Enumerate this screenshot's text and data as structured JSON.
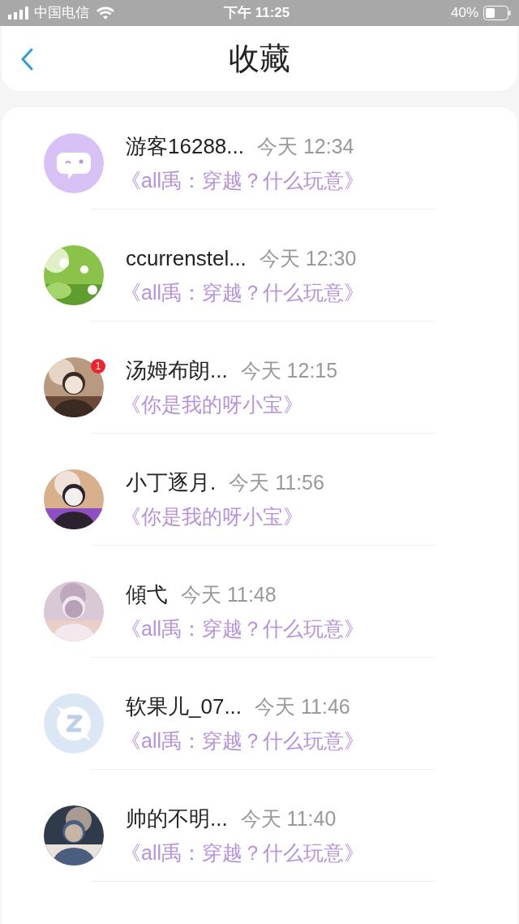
{
  "status_bar": {
    "carrier": "中国电信",
    "time": "下午 11:25",
    "battery": "40%"
  },
  "header": {
    "title": "收藏"
  },
  "items": [
    {
      "name": "游客16288...",
      "time": "今天 12:34",
      "title": "《all禹：穿越？什么玩意》",
      "avatar": {
        "kind": "chat"
      }
    },
    {
      "name": "ccurrenstel...",
      "time": "今天 12:30",
      "title": "《all禹：穿越？什么玩意》"
    },
    {
      "name": "汤姆布朗...",
      "time": "今天 12:15",
      "title": "《你是我的呀小宝》",
      "badge": "1"
    },
    {
      "name": "小丁逐月.",
      "time": "今天 11:56",
      "title": "《你是我的呀小宝》"
    },
    {
      "name": "傾弋",
      "time": "今天 11:48",
      "title": "《all禹：穿越？什么玩意》"
    },
    {
      "name": "软果儿_07...",
      "time": "今天 11:46",
      "title": "《all禹：穿越？什么玩意》",
      "avatar": {
        "kind": "z"
      }
    },
    {
      "name": "帅的不明...",
      "time": "今天 11:40",
      "title": "《all禹：穿越？什么玩意》"
    }
  ]
}
